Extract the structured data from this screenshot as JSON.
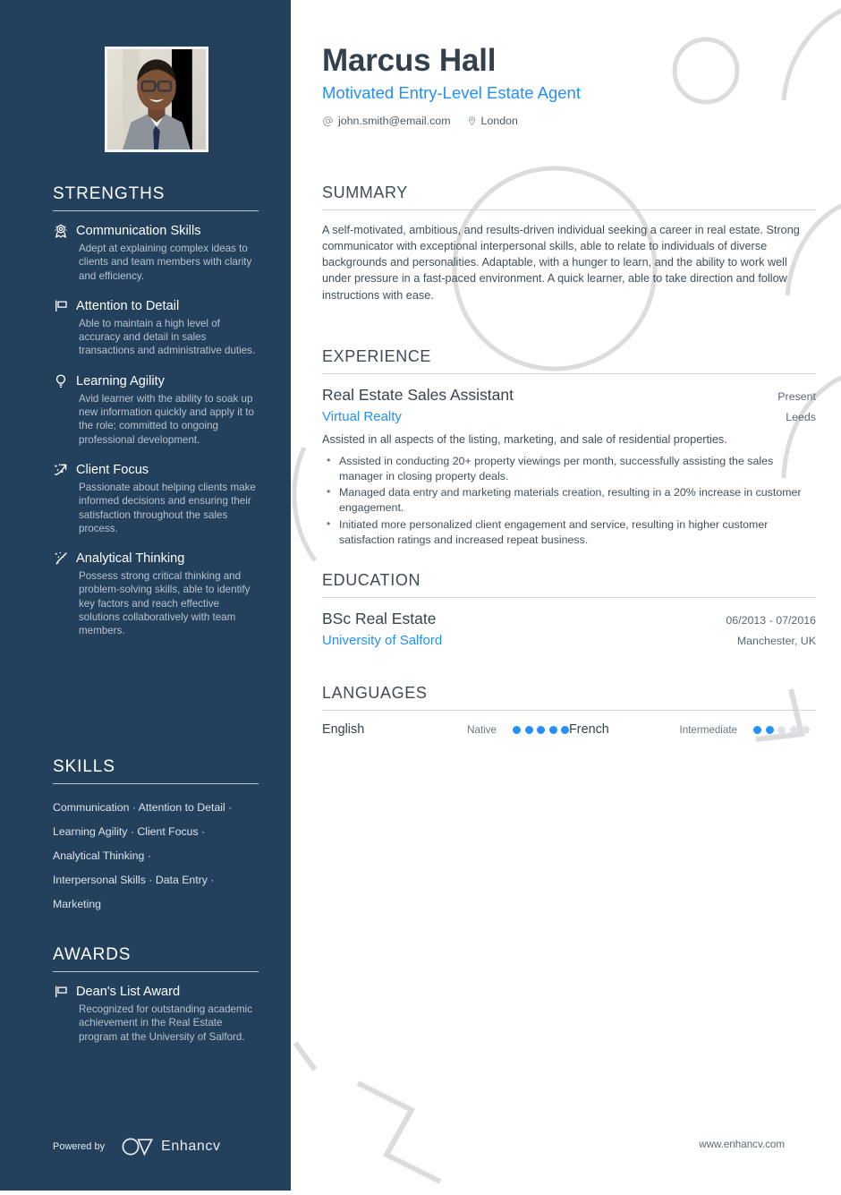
{
  "theme": {
    "sidebar_bg": "#23405c",
    "accent": "#2490f8",
    "heading": "#3f4b57",
    "body": "#42505c"
  },
  "header": {
    "name": "Marcus Hall",
    "role": "Motivated Entry-Level Estate Agent",
    "contacts": [
      {
        "icon": "at-icon",
        "value": "john.smith@email.com"
      },
      {
        "icon": "location-pin-icon",
        "value": "London"
      }
    ]
  },
  "sidebar": {
    "photo_alt": "profile-photo",
    "strengths_heading": "STRENGTHS",
    "strengths": [
      {
        "icon": "award-badge-icon",
        "title": "Communication Skills",
        "desc": "Adept at explaining complex ideas to clients and team members with clarity and efficiency."
      },
      {
        "icon": "flag-icon",
        "title": "Attention to Detail",
        "desc": "Able to maintain a high level of accuracy and detail in sales transactions and administrative duties."
      },
      {
        "icon": "lightbulb-icon",
        "title": "Learning Agility",
        "desc": "Avid learner with the ability to soak up new information quickly and apply it to the role; committed to ongoing professional development."
      },
      {
        "icon": "growth-arrow-icon",
        "title": "Client Focus",
        "desc": "Passionate about helping clients make informed decisions and ensuring their satisfaction throughout the sales process."
      },
      {
        "icon": "magic-wand-icon",
        "title": "Analytical Thinking",
        "desc": "Possess strong critical thinking and problem-solving skills, able to identify key factors and reach effective solutions collaboratively with team members."
      }
    ],
    "skills_heading": "SKILLS",
    "skills_lines": [
      "Communication · Attention to Detail ·",
      "Learning Agility · Client Focus ·",
      "Analytical Thinking ·",
      "Interpersonal Skills · Data Entry ·",
      "Marketing"
    ],
    "awards_heading": "AWARDS",
    "awards": [
      {
        "icon": "flag-icon",
        "title": "Dean's List Award",
        "desc": "Recognized for outstanding academic achievement in the Real Estate program at the University of Salford."
      }
    ]
  },
  "main": {
    "summary_heading": "SUMMARY",
    "summary_text": "A self-motivated, ambitious, and results-driven individual seeking a career in real estate. Strong communicator with exceptional interpersonal skills, able to relate to individuals of diverse backgrounds and personalities. Adaptable, with a hunger to learn, and the ability to work well under pressure in a fast-paced environment. A quick learner, able to take direction and follow instructions with ease.",
    "experience_heading": "EXPERIENCE",
    "experience": [
      {
        "title": "Real Estate Sales Assistant",
        "date": "Present",
        "org": "Virtual Realty",
        "location": "Leeds",
        "intro": "Assisted in all aspects of the listing, marketing, and sale of residential properties.",
        "bullets": [
          "Assisted in conducting 20+ property viewings per month, successfully assisting the sales manager in closing property deals.",
          "Managed data entry and marketing materials creation, resulting in a 20% increase in customer engagement.",
          "Initiated more personalized client engagement and service, resulting in higher customer satisfaction ratings and increased repeat business."
        ]
      }
    ],
    "education_heading": "EDUCATION",
    "education": [
      {
        "degree": "BSc Real Estate",
        "date": "06/2013 - 07/2016",
        "school": "University of Salford",
        "location": "Manchester, UK"
      }
    ],
    "languages_heading": "LANGUAGES",
    "languages": [
      {
        "name": "English",
        "level": "Native",
        "filled": 5,
        "total": 5
      },
      {
        "name": "French",
        "level": "Intermediate",
        "filled": 2,
        "total": 5
      }
    ]
  },
  "footer": {
    "powered_by": "Powered by",
    "brand": "Enhancv",
    "website": "www.enhancv.com"
  }
}
